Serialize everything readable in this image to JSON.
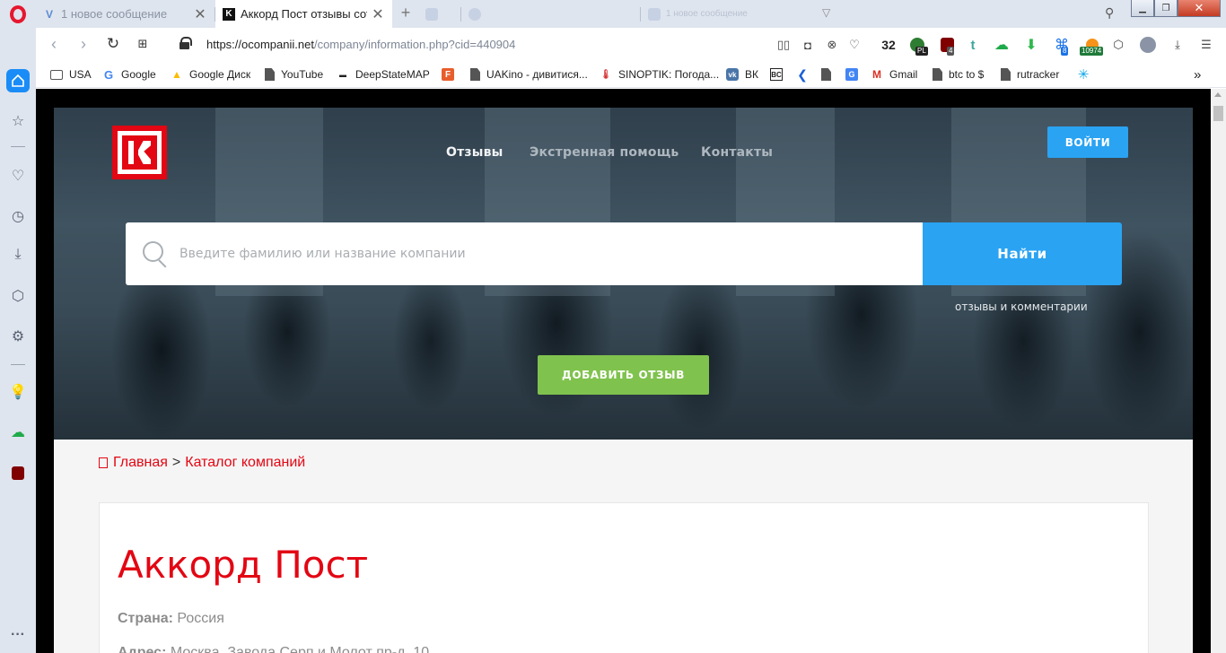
{
  "browser": {
    "tabs": [
      {
        "title": "1 новое сообщение",
        "favicon": "v-icon"
      },
      {
        "title": "Аккорд Пост отзывы сотр",
        "favicon": "k-logo-icon"
      },
      {
        "title": "",
        "favicon": ""
      },
      {
        "title": "",
        "favicon": ""
      },
      {
        "title": "1 новое сообщение",
        "favicon": ""
      }
    ],
    "url": {
      "base": "https://ocompanii.net",
      "path": "/company/information.php?cid=440904"
    },
    "extensions": {
      "count_badge": "32",
      "badge_pl": "PL",
      "badge_4": "4",
      "badge_8": "8",
      "badge_10974": "10974"
    },
    "bookmarks": [
      {
        "label": "USA",
        "icon": "folder"
      },
      {
        "label": "Google",
        "icon": "google"
      },
      {
        "label": "Google Диск",
        "icon": "drive"
      },
      {
        "label": "YouTube",
        "icon": "doc"
      },
      {
        "label": "DeepStateMAP",
        "icon": "deepstate"
      },
      {
        "label": "",
        "icon": "f-orange"
      },
      {
        "label": "UAKino - дивитися...",
        "icon": "doc"
      },
      {
        "label": "SINOPTIK: Погода...",
        "icon": "thermo"
      },
      {
        "label": "ВК",
        "icon": "vk"
      },
      {
        "label": "",
        "icon": "bc"
      },
      {
        "label": "",
        "icon": "chevron"
      },
      {
        "label": "",
        "icon": "doc"
      },
      {
        "label": "",
        "icon": "translate"
      },
      {
        "label": "Gmail",
        "icon": "gmail"
      },
      {
        "label": "btc to $",
        "icon": "doc"
      },
      {
        "label": "rutracker",
        "icon": "doc"
      },
      {
        "label": "",
        "icon": "kyivstar"
      }
    ],
    "more": "»"
  },
  "site": {
    "nav": [
      {
        "label": "Отзывы",
        "active": true
      },
      {
        "label": "Экстренная помощь",
        "active": false
      },
      {
        "label": "Контакты",
        "active": false
      }
    ],
    "login_label": "ВОЙТИ",
    "search": {
      "placeholder": "Введите фамилию или название компании",
      "button": "Найти"
    },
    "hero_sub": "отзывы и комментарии",
    "add_review": "ДОБАВИТЬ ОТЗЫВ",
    "breadcrumb": {
      "home": "Главная",
      "sep": ">",
      "catalog": "Каталог компаний"
    },
    "company": {
      "name": "Аккорд Пост",
      "country_label": "Страна:",
      "country": "Россия",
      "address_label": "Адрес:",
      "address": "Москва, Завода Серп и Молот пр-д, 10"
    }
  },
  "colors": {
    "accent_blue": "#2aa3f2",
    "brand_red": "#e30613",
    "add_green": "#80c24e"
  }
}
